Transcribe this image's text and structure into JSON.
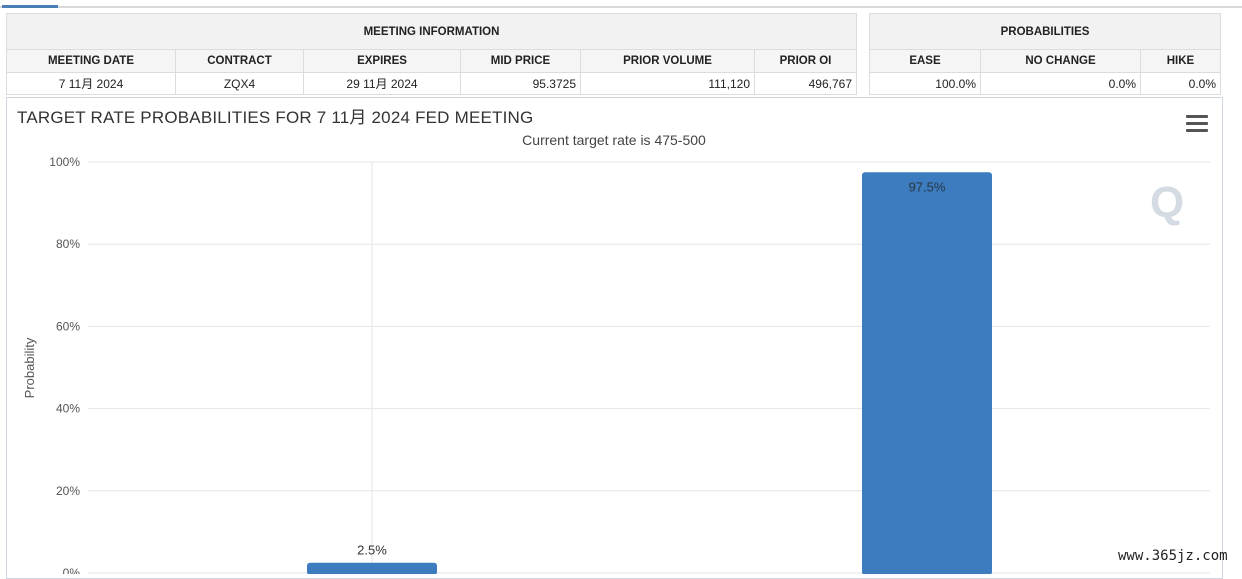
{
  "meeting_info": {
    "group_header": "MEETING INFORMATION",
    "columns": [
      "MEETING DATE",
      "CONTRACT",
      "EXPIRES",
      "MID PRICE",
      "PRIOR VOLUME",
      "PRIOR OI"
    ],
    "row": [
      "7 11月 2024",
      "ZQX4",
      "29 11月 2024",
      "95.3725",
      "111,120",
      "496,767"
    ]
  },
  "probabilities": {
    "group_header": "PROBABILITIES",
    "columns": [
      "EASE",
      "NO CHANGE",
      "HIKE"
    ],
    "row": [
      "100.0%",
      "0.0%",
      "0.0%"
    ]
  },
  "chart_title": "TARGET RATE PROBABILITIES FOR 7 11月 2024 FED MEETING",
  "chart_subtitle": "Current target rate is 475-500",
  "watermark": "www.365jz.com",
  "logo_letter": "Q",
  "icons": {
    "menu": "hamburger-menu-icon"
  },
  "colors": {
    "bar": "#3d7dbf",
    "grid": "#e6e6e6",
    "accent": "#4a7fb5"
  },
  "chart_data": {
    "type": "bar",
    "title": "TARGET RATE PROBABILITIES FOR 7 11月 2024 FED MEETING",
    "subtitle": "Current target rate is 475-500",
    "xlabel": "",
    "ylabel": "Probability",
    "categories": [
      "",
      ""
    ],
    "values": [
      2.5,
      97.5
    ],
    "data_labels": [
      "2.5%",
      "97.5%"
    ],
    "yticks": [
      "0%",
      "20%",
      "40%",
      "60%",
      "80%",
      "100%"
    ],
    "ylim": [
      0,
      100
    ],
    "grid": true
  }
}
